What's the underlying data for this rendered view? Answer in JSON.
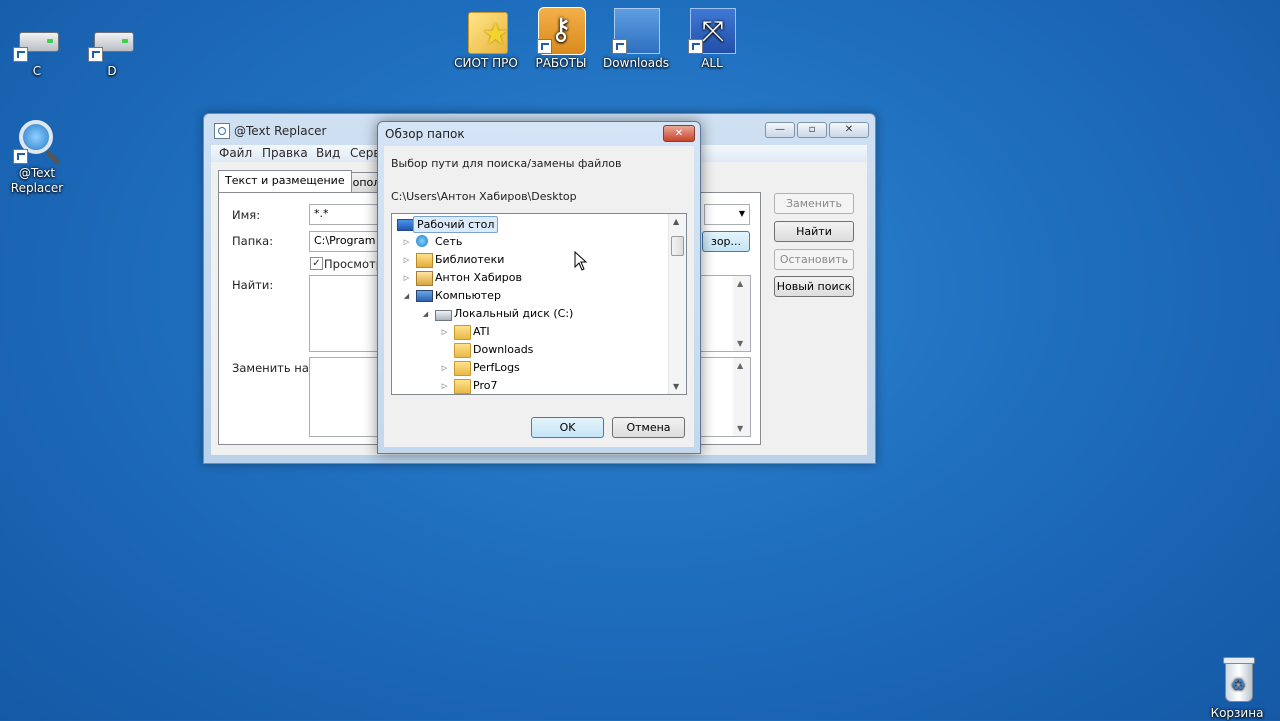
{
  "desktop": {
    "icons": [
      {
        "label": "C"
      },
      {
        "label": "D"
      },
      {
        "label": "СИОТ ПРО"
      },
      {
        "label": "РАБОТЫ"
      },
      {
        "label": "Downloads"
      },
      {
        "label": "ALL"
      },
      {
        "label": "@Text\nReplacer"
      },
      {
        "label": "Корзина"
      }
    ]
  },
  "app_window": {
    "title": "@Text Replacer",
    "menu": [
      "Файл",
      "Правка",
      "Вид",
      "Серв"
    ],
    "tabs": [
      "Текст и размещение",
      "Дополн"
    ],
    "labels": {
      "name": "Имя:",
      "folder": "Папка:",
      "find": "Найти:",
      "replace_with": "Заменить на:",
      "view_checkbox": "Просмотре"
    },
    "fields": {
      "name_value": "*.*",
      "folder_value": "C:\\Program F",
      "browse_button": "зор..."
    },
    "buttons": {
      "replace": "Заменить",
      "find": "Найти",
      "stop": "Остановить",
      "new_search": "Новый поиск"
    },
    "caption_buttons": {
      "minimize": "—",
      "maximize": "▫",
      "close": "✕"
    }
  },
  "browse_dialog": {
    "title": "Обзор папок",
    "description": "Выбор пути для поиска/замены файлов",
    "current_path": "C:\\Users\\Антон Хабиров\\Desktop",
    "tree": [
      {
        "label": "Рабочий стол",
        "icon": "desktop-icon",
        "selected": true
      },
      {
        "label": "Сеть",
        "icon": "network-icon"
      },
      {
        "label": "Библиотеки",
        "icon": "libraries-icon"
      },
      {
        "label": "Антон Хабиров",
        "icon": "user-folder-icon"
      },
      {
        "label": "Компьютер",
        "icon": "computer-icon"
      },
      {
        "label": "Локальный диск (C:)",
        "icon": "drive-icon"
      },
      {
        "label": "ATI",
        "icon": "folder-icon"
      },
      {
        "label": "Downloads",
        "icon": "folder-icon"
      },
      {
        "label": "PerfLogs",
        "icon": "folder-icon"
      },
      {
        "label": "Pro7",
        "icon": "folder-icon"
      }
    ],
    "ok": "OK",
    "cancel": "Отмена",
    "close": "✕"
  }
}
